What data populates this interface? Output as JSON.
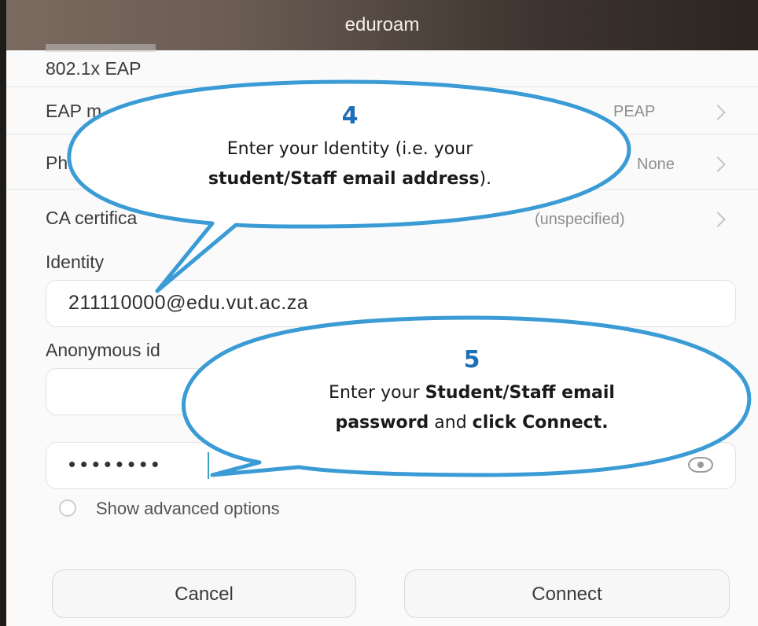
{
  "window": {
    "title": "eduroam"
  },
  "security": {
    "value": "802.1x EAP"
  },
  "settings": [
    {
      "label": "EAP m",
      "value": "PEAP"
    },
    {
      "label": "Ph",
      "value": "None"
    },
    {
      "label": "CA certifica",
      "value": "(unspecified)"
    }
  ],
  "identity": {
    "label": "Identity",
    "value": "211110000@edu.vut.ac.za"
  },
  "anonymous": {
    "label": "Anonymous id",
    "value": ""
  },
  "password": {
    "masked": "••••••••"
  },
  "advanced": {
    "label": "Show advanced options"
  },
  "buttons": {
    "cancel": "Cancel",
    "connect": "Connect"
  },
  "callout4": {
    "number": "4",
    "line1": "Enter your Identity (i.e. your",
    "line2_bold": "student/Staff email address",
    "line2_tail": ")."
  },
  "callout5": {
    "number": "5",
    "line1_plain": "Enter your ",
    "line1_bold": "Student/Staff email",
    "line2_bold1": "password",
    "line2_plain": " and ",
    "line2_bold2": "click Connect."
  },
  "colors": {
    "callout_border": "#3a9bd5",
    "number": "#1d6fb6"
  }
}
